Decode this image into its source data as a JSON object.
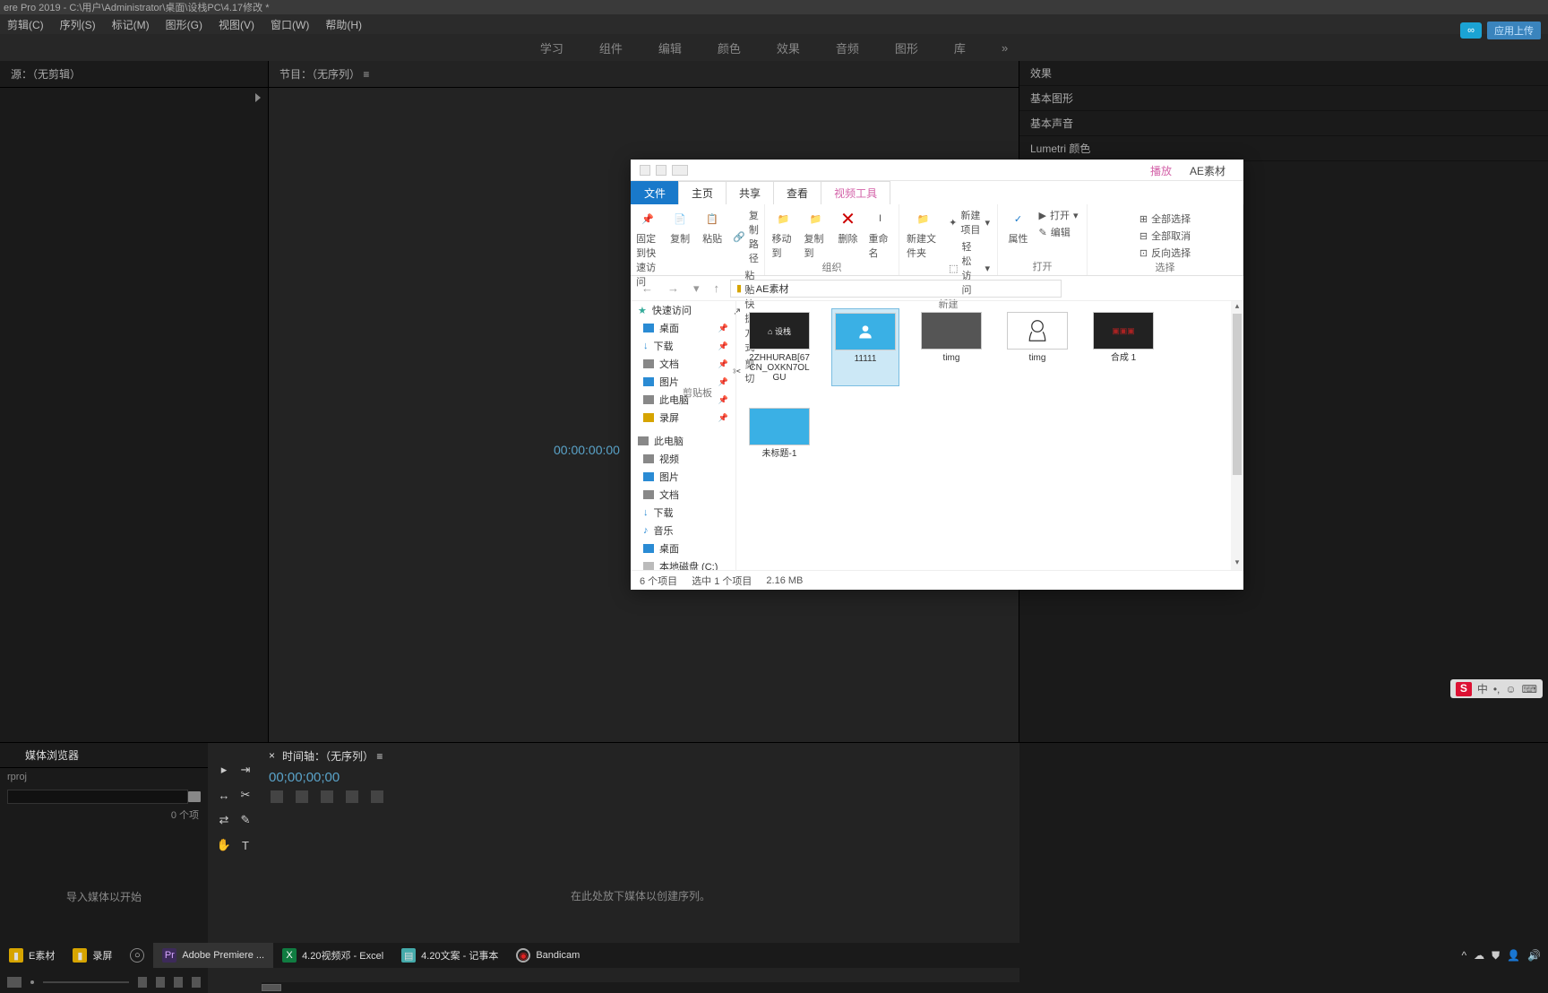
{
  "titlebar": "ere Pro 2019 - C:\\用户\\Administrator\\桌面\\设栈PC\\4.17修改 *",
  "menu": [
    "剪辑(C)",
    "序列(S)",
    "标记(M)",
    "图形(G)",
    "视图(V)",
    "窗口(W)",
    "帮助(H)"
  ],
  "workspaces": [
    "学习",
    "组件",
    "编辑",
    "颜色",
    "效果",
    "音频",
    "图形",
    "库",
    "»"
  ],
  "sync_label": "应用上传",
  "panels": {
    "source": "源：（无剪辑）",
    "program": "节目：（无序列） ≡",
    "media_browser_tab": "媒体浏览器",
    "media_proj": "rproj",
    "items_count": "0 个项",
    "import_hint": "导入媒体以开始",
    "timeline_tab": "时间轴：（无序列） ≡",
    "timeline_tc": "00;00;00;00",
    "prog_tc": "00:00:00:00",
    "timeline_hint": "在此处放下媒体以创建序列。"
  },
  "fx": [
    "效果",
    "基本图形",
    "基本声音",
    "Lumetri 颜色"
  ],
  "explorer": {
    "title_tab": "播放",
    "title_plain": "AE素材",
    "tabs": [
      "文件",
      "主页",
      "共享",
      "查看",
      "视频工具"
    ],
    "ribbon_groups": {
      "clipboard": {
        "pin": "固定到快速访问",
        "copy": "复制",
        "paste": "粘贴",
        "path": "复制路径",
        "shortcut": "粘贴快捷方式",
        "cut": "剪切",
        "label": "剪贴板"
      },
      "organize": {
        "moveto": "移动到",
        "copyto": "复制到",
        "delete": "删除",
        "rename": "重命名",
        "label": "组织"
      },
      "new": {
        "folder": "新建文件夹",
        "item": "新建项目",
        "easy": "轻松访问",
        "label": "新建"
      },
      "open": {
        "props": "属性",
        "open": "打开",
        "edit": "编辑",
        "label": "打开"
      },
      "select": {
        "all": "全部选择",
        "none": "全部取消",
        "inv": "反向选择",
        "label": "选择"
      }
    },
    "breadcrumb": "AE素材",
    "nav": {
      "quick": "快速访问",
      "items1": [
        "桌面",
        "下载",
        "文档",
        "图片",
        "此电脑",
        "录屏"
      ],
      "thispc": "此电脑",
      "items2": [
        "视频",
        "图片",
        "文档",
        "下载",
        "音乐",
        "桌面",
        "本地磁盘 (C:)"
      ]
    },
    "files": [
      {
        "name": "2ZHHURAB[67CN_OXKN7OLGU",
        "type": "dark"
      },
      {
        "name": "11111",
        "type": "blue",
        "sel": true
      },
      {
        "name": "timg",
        "type": "photo"
      },
      {
        "name": "timg",
        "type": "line"
      },
      {
        "name": "合成 1",
        "type": "film"
      },
      {
        "name": "未标题-1",
        "type": "blue"
      }
    ],
    "status_left": "6 个项目",
    "status_mid": "选中 1 个项目",
    "status_size": "2.16 MB"
  },
  "taskbar": {
    "items": [
      {
        "label": "E素材",
        "color": "#d6a400"
      },
      {
        "label": "录屏",
        "color": "#d6a400"
      },
      {
        "label": "",
        "color": "#888",
        "round": true
      },
      {
        "label": "Adobe Premiere ...",
        "color": "#3d2a5a",
        "badge": "Pr"
      },
      {
        "label": "4.20视频邓 - Excel",
        "color": "#107c41",
        "badge": "X"
      },
      {
        "label": "4.20文案 - 记事本",
        "color": "#5aa",
        "badge": ""
      },
      {
        "label": "Bandicam",
        "color": "#d22",
        "round": true
      }
    ]
  },
  "ime": [
    "中",
    "•,",
    "☺",
    "⌨"
  ]
}
